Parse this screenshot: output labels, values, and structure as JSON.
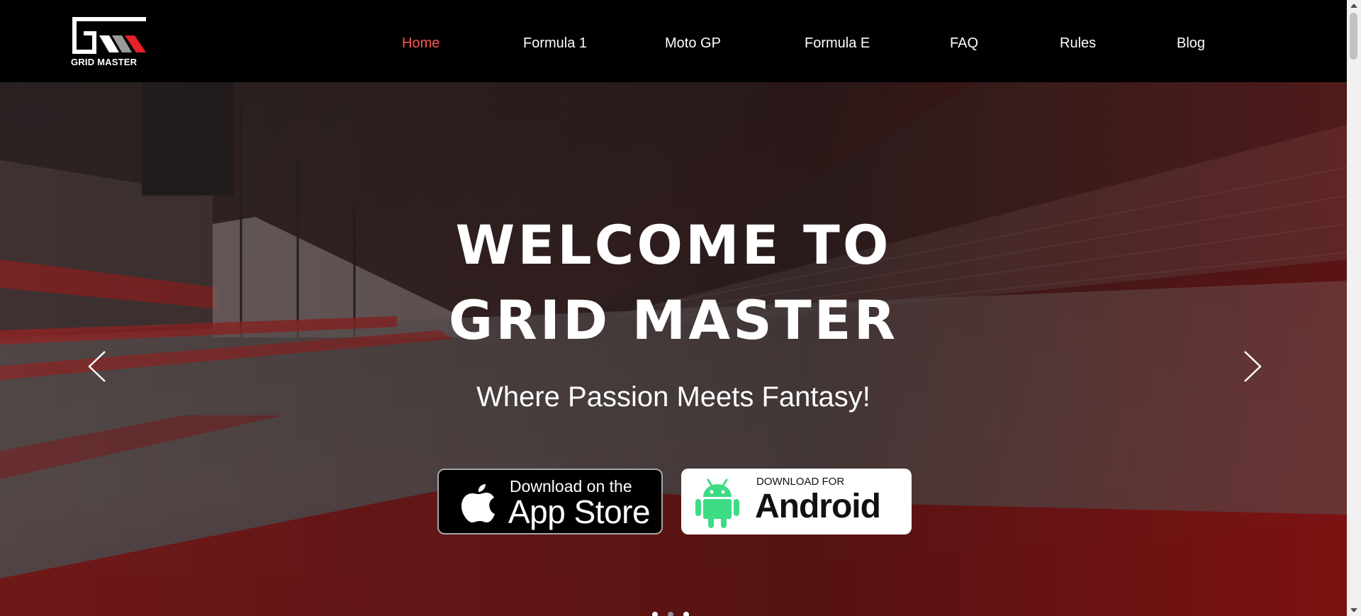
{
  "brand": {
    "logo_text": "GRID MASTER"
  },
  "nav": {
    "items": [
      {
        "label": "Home",
        "active": true
      },
      {
        "label": "Formula 1",
        "active": false
      },
      {
        "label": "Moto GP",
        "active": false
      },
      {
        "label": "Formula E",
        "active": false
      },
      {
        "label": "FAQ",
        "active": false
      },
      {
        "label": "Rules",
        "active": false
      },
      {
        "label": "Blog",
        "active": false
      }
    ]
  },
  "hero": {
    "headline_line1": "WELCOME TO",
    "headline_line2": "GRID MASTER",
    "tagline": "Where Passion Meets Fantasy!",
    "prev_icon": "chevron-left-icon",
    "next_icon": "chevron-right-icon",
    "slides_total": 3,
    "active_slide": 1
  },
  "downloads": {
    "appstore": {
      "small": "Download on the",
      "big": "App Store",
      "icon": "apple-icon"
    },
    "android": {
      "small": "DOWNLOAD FOR",
      "big": "Android",
      "icon": "android-icon"
    }
  },
  "colors": {
    "header_bg": "#000000",
    "active_nav": "#ff5252",
    "brand_red": "#e8202a",
    "android_green": "#3ddc84"
  }
}
